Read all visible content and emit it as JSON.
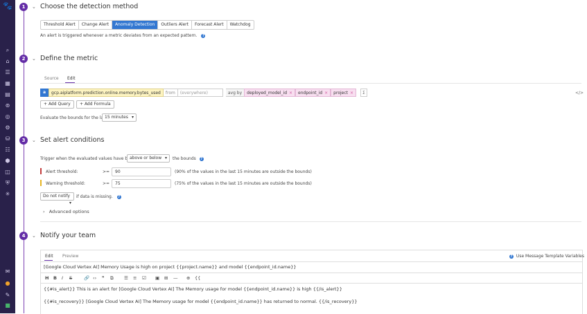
{
  "steps": [
    {
      "num": "1",
      "title": "Choose the detection method"
    },
    {
      "num": "2",
      "title": "Define the metric"
    },
    {
      "num": "3",
      "title": "Set alert conditions"
    },
    {
      "num": "4",
      "title": "Notify your team"
    }
  ],
  "detection": {
    "methods": [
      "Threshold Alert",
      "Change Alert",
      "Anomaly Detection",
      "Outliers Alert",
      "Forecast Alert",
      "Watchdog"
    ],
    "selected": "Anomaly Detection",
    "description": "An alert is triggered whenever a metric deviates from an expected pattern."
  },
  "metric": {
    "tabs": [
      "Source",
      "Edit"
    ],
    "active_tab": "Edit",
    "query_letter": "a",
    "metric_name": "gcp.aiplatform.prediction.online.memory.bytes_used",
    "from_label": "from",
    "from_placeholder": "(everywhere)",
    "avg_by_label": "avg by",
    "group_by": [
      "deployed_model_id",
      "endpoint_id",
      "project"
    ],
    "sigma": "Σ",
    "code_toggle": "</>",
    "add_query": "Add Query",
    "add_formula": "Add Formula",
    "evaluate_label": "Evaluate the bounds for the last",
    "evaluate_value": "15 minutes"
  },
  "conditions": {
    "trigger_label": "Trigger when the evaluated values have been",
    "trigger_value": "above or below",
    "trigger_suffix": "the bounds",
    "alert_label": "Alert threshold:",
    "alert_op": ">=",
    "alert_value": "90",
    "alert_note": "(90% of the values in the last 15 minutes are outside the bounds)",
    "warning_label": "Warning threshold:",
    "warning_op": ">=",
    "warning_value": "75",
    "warning_note": "(75% of the values in the last 15 minutes are outside the bounds)",
    "missing_value": "Do not notify",
    "missing_suffix": "if data is missing.",
    "advanced": "Advanced options"
  },
  "notify": {
    "tabs": [
      "Edit",
      "Preview"
    ],
    "active_tab": "Edit",
    "template_link": "Use Message Template Variables",
    "title_value": "[Google Cloud Vertex AI] Memory Usage is high on project {{project.name}} and model {{endpoint_id.name}}",
    "body_line1": "{{#is_alert}} This is an alert for [Google Cloud Vertex AI] The Memory usage for model {{endpoint_id.name}} is high {{/is_alert}}",
    "body_line2": "{{#is_recovery}} [Google Cloud Vertex AI] The Memory usage for model {{endpoint_id.name}} has returned to normal. {{/is_recovery}}",
    "toolbar": [
      "H",
      "B",
      "I",
      "S"
    ]
  },
  "colors": {
    "accent": "#632ca6",
    "selected": "#3277d1",
    "sidebar": "#29214a"
  }
}
